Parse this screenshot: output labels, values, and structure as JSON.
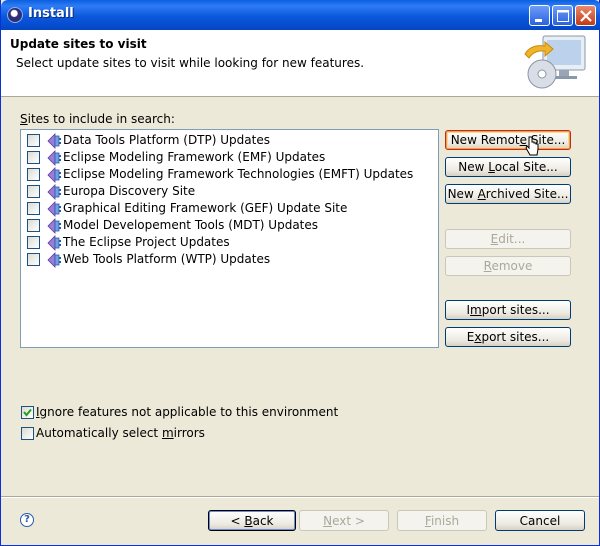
{
  "window": {
    "title": "Install",
    "minimize_icon": "minimize-icon",
    "maximize_icon": "maximize-icon",
    "close_icon": "close-icon"
  },
  "header": {
    "title": "Update sites to visit",
    "description": "Select update sites to visit while looking for new features."
  },
  "sites": {
    "label_prefix": "S",
    "label_rest": "ites to include in search:",
    "items": [
      {
        "label": "Data Tools Platform (DTP) Updates",
        "checked": false
      },
      {
        "label": "Eclipse Modeling Framework (EMF) Updates",
        "checked": false
      },
      {
        "label": "Eclipse Modeling Framework Technologies (EMFT) Updates",
        "checked": false
      },
      {
        "label": "Europa Discovery Site",
        "checked": false
      },
      {
        "label": "Graphical Editing Framework (GEF) Update Site",
        "checked": false
      },
      {
        "label": "Model Developement Tools (MDT) Updates",
        "checked": false
      },
      {
        "label": "The Eclipse Project Updates",
        "checked": false
      },
      {
        "label": "Web Tools Platform (WTP) Updates",
        "checked": false
      }
    ]
  },
  "buttons": {
    "new_remote": {
      "pre": "New Remot",
      "mn": "e",
      "post": " Site..."
    },
    "new_local": {
      "pre": "New ",
      "mn": "L",
      "post": "ocal Site..."
    },
    "new_archived": {
      "pre": "New ",
      "mn": "A",
      "post": "rchived Site..."
    },
    "edit": {
      "pre": "",
      "mn": "E",
      "post": "dit..."
    },
    "remove": {
      "pre": "",
      "mn": "R",
      "post": "emove"
    },
    "import": {
      "pre": "I",
      "mn": "m",
      "post": "port sites..."
    },
    "export": {
      "pre": "E",
      "mn": "x",
      "post": "port sites..."
    }
  },
  "options": {
    "ignore": {
      "mn": "I",
      "rest": "gnore features not applicable to this environment",
      "checked": true
    },
    "mirrors": {
      "pre": "Automatically select ",
      "mn": "m",
      "post": "irrors",
      "checked": false
    }
  },
  "footer": {
    "back": {
      "pre": "< ",
      "mn": "B",
      "post": "ack"
    },
    "next": {
      "pre": "",
      "mn": "N",
      "post": "ext >"
    },
    "finish": {
      "pre": "",
      "mn": "F",
      "post": "inish"
    },
    "cancel": "Cancel",
    "help_glyph": "?"
  }
}
